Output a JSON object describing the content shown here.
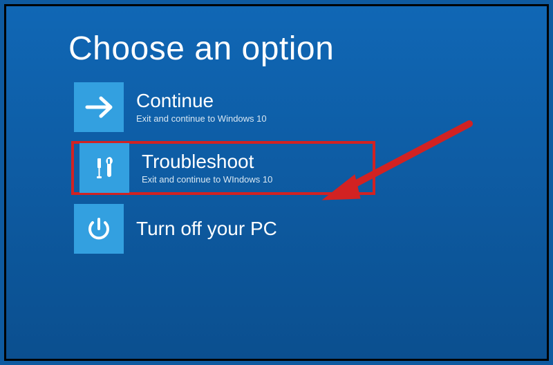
{
  "header": {
    "title": "Choose an option"
  },
  "options": [
    {
      "icon": "arrow-right-icon",
      "title": "Continue",
      "subtitle": "Exit and continue to Windows 10",
      "highlighted": false
    },
    {
      "icon": "tools-icon",
      "title": "Troubleshoot",
      "subtitle": "Exit and continue to WIndows 10",
      "highlighted": true
    },
    {
      "icon": "power-icon",
      "title": "Turn off your PC",
      "subtitle": "",
      "highlighted": false
    }
  ],
  "annotation": {
    "has_red_arrow": true,
    "points_to_option_index": 1
  },
  "colors": {
    "background_top": "#1067b5",
    "background_bottom": "#0b4f8f",
    "tile": "#33a0e0",
    "highlight_border": "#d22222",
    "frame": "#000000"
  }
}
